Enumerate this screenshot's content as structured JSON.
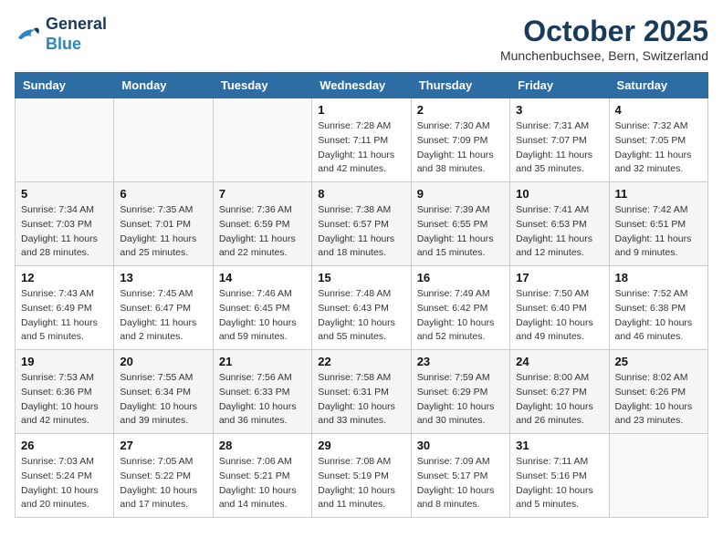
{
  "header": {
    "logo_line1": "General",
    "logo_line2": "Blue",
    "month": "October 2025",
    "location": "Munchenbuchsee, Bern, Switzerland"
  },
  "days_of_week": [
    "Sunday",
    "Monday",
    "Tuesday",
    "Wednesday",
    "Thursday",
    "Friday",
    "Saturday"
  ],
  "weeks": [
    [
      {
        "day": "",
        "sunrise": "",
        "sunset": "",
        "daylight": ""
      },
      {
        "day": "",
        "sunrise": "",
        "sunset": "",
        "daylight": ""
      },
      {
        "day": "",
        "sunrise": "",
        "sunset": "",
        "daylight": ""
      },
      {
        "day": "1",
        "sunrise": "Sunrise: 7:28 AM",
        "sunset": "Sunset: 7:11 PM",
        "daylight": "Daylight: 11 hours and 42 minutes."
      },
      {
        "day": "2",
        "sunrise": "Sunrise: 7:30 AM",
        "sunset": "Sunset: 7:09 PM",
        "daylight": "Daylight: 11 hours and 38 minutes."
      },
      {
        "day": "3",
        "sunrise": "Sunrise: 7:31 AM",
        "sunset": "Sunset: 7:07 PM",
        "daylight": "Daylight: 11 hours and 35 minutes."
      },
      {
        "day": "4",
        "sunrise": "Sunrise: 7:32 AM",
        "sunset": "Sunset: 7:05 PM",
        "daylight": "Daylight: 11 hours and 32 minutes."
      }
    ],
    [
      {
        "day": "5",
        "sunrise": "Sunrise: 7:34 AM",
        "sunset": "Sunset: 7:03 PM",
        "daylight": "Daylight: 11 hours and 28 minutes."
      },
      {
        "day": "6",
        "sunrise": "Sunrise: 7:35 AM",
        "sunset": "Sunset: 7:01 PM",
        "daylight": "Daylight: 11 hours and 25 minutes."
      },
      {
        "day": "7",
        "sunrise": "Sunrise: 7:36 AM",
        "sunset": "Sunset: 6:59 PM",
        "daylight": "Daylight: 11 hours and 22 minutes."
      },
      {
        "day": "8",
        "sunrise": "Sunrise: 7:38 AM",
        "sunset": "Sunset: 6:57 PM",
        "daylight": "Daylight: 11 hours and 18 minutes."
      },
      {
        "day": "9",
        "sunrise": "Sunrise: 7:39 AM",
        "sunset": "Sunset: 6:55 PM",
        "daylight": "Daylight: 11 hours and 15 minutes."
      },
      {
        "day": "10",
        "sunrise": "Sunrise: 7:41 AM",
        "sunset": "Sunset: 6:53 PM",
        "daylight": "Daylight: 11 hours and 12 minutes."
      },
      {
        "day": "11",
        "sunrise": "Sunrise: 7:42 AM",
        "sunset": "Sunset: 6:51 PM",
        "daylight": "Daylight: 11 hours and 9 minutes."
      }
    ],
    [
      {
        "day": "12",
        "sunrise": "Sunrise: 7:43 AM",
        "sunset": "Sunset: 6:49 PM",
        "daylight": "Daylight: 11 hours and 5 minutes."
      },
      {
        "day": "13",
        "sunrise": "Sunrise: 7:45 AM",
        "sunset": "Sunset: 6:47 PM",
        "daylight": "Daylight: 11 hours and 2 minutes."
      },
      {
        "day": "14",
        "sunrise": "Sunrise: 7:46 AM",
        "sunset": "Sunset: 6:45 PM",
        "daylight": "Daylight: 10 hours and 59 minutes."
      },
      {
        "day": "15",
        "sunrise": "Sunrise: 7:48 AM",
        "sunset": "Sunset: 6:43 PM",
        "daylight": "Daylight: 10 hours and 55 minutes."
      },
      {
        "day": "16",
        "sunrise": "Sunrise: 7:49 AM",
        "sunset": "Sunset: 6:42 PM",
        "daylight": "Daylight: 10 hours and 52 minutes."
      },
      {
        "day": "17",
        "sunrise": "Sunrise: 7:50 AM",
        "sunset": "Sunset: 6:40 PM",
        "daylight": "Daylight: 10 hours and 49 minutes."
      },
      {
        "day": "18",
        "sunrise": "Sunrise: 7:52 AM",
        "sunset": "Sunset: 6:38 PM",
        "daylight": "Daylight: 10 hours and 46 minutes."
      }
    ],
    [
      {
        "day": "19",
        "sunrise": "Sunrise: 7:53 AM",
        "sunset": "Sunset: 6:36 PM",
        "daylight": "Daylight: 10 hours and 42 minutes."
      },
      {
        "day": "20",
        "sunrise": "Sunrise: 7:55 AM",
        "sunset": "Sunset: 6:34 PM",
        "daylight": "Daylight: 10 hours and 39 minutes."
      },
      {
        "day": "21",
        "sunrise": "Sunrise: 7:56 AM",
        "sunset": "Sunset: 6:33 PM",
        "daylight": "Daylight: 10 hours and 36 minutes."
      },
      {
        "day": "22",
        "sunrise": "Sunrise: 7:58 AM",
        "sunset": "Sunset: 6:31 PM",
        "daylight": "Daylight: 10 hours and 33 minutes."
      },
      {
        "day": "23",
        "sunrise": "Sunrise: 7:59 AM",
        "sunset": "Sunset: 6:29 PM",
        "daylight": "Daylight: 10 hours and 30 minutes."
      },
      {
        "day": "24",
        "sunrise": "Sunrise: 8:00 AM",
        "sunset": "Sunset: 6:27 PM",
        "daylight": "Daylight: 10 hours and 26 minutes."
      },
      {
        "day": "25",
        "sunrise": "Sunrise: 8:02 AM",
        "sunset": "Sunset: 6:26 PM",
        "daylight": "Daylight: 10 hours and 23 minutes."
      }
    ],
    [
      {
        "day": "26",
        "sunrise": "Sunrise: 7:03 AM",
        "sunset": "Sunset: 5:24 PM",
        "daylight": "Daylight: 10 hours and 20 minutes."
      },
      {
        "day": "27",
        "sunrise": "Sunrise: 7:05 AM",
        "sunset": "Sunset: 5:22 PM",
        "daylight": "Daylight: 10 hours and 17 minutes."
      },
      {
        "day": "28",
        "sunrise": "Sunrise: 7:06 AM",
        "sunset": "Sunset: 5:21 PM",
        "daylight": "Daylight: 10 hours and 14 minutes."
      },
      {
        "day": "29",
        "sunrise": "Sunrise: 7:08 AM",
        "sunset": "Sunset: 5:19 PM",
        "daylight": "Daylight: 10 hours and 11 minutes."
      },
      {
        "day": "30",
        "sunrise": "Sunrise: 7:09 AM",
        "sunset": "Sunset: 5:17 PM",
        "daylight": "Daylight: 10 hours and 8 minutes."
      },
      {
        "day": "31",
        "sunrise": "Sunrise: 7:11 AM",
        "sunset": "Sunset: 5:16 PM",
        "daylight": "Daylight: 10 hours and 5 minutes."
      },
      {
        "day": "",
        "sunrise": "",
        "sunset": "",
        "daylight": ""
      }
    ]
  ]
}
